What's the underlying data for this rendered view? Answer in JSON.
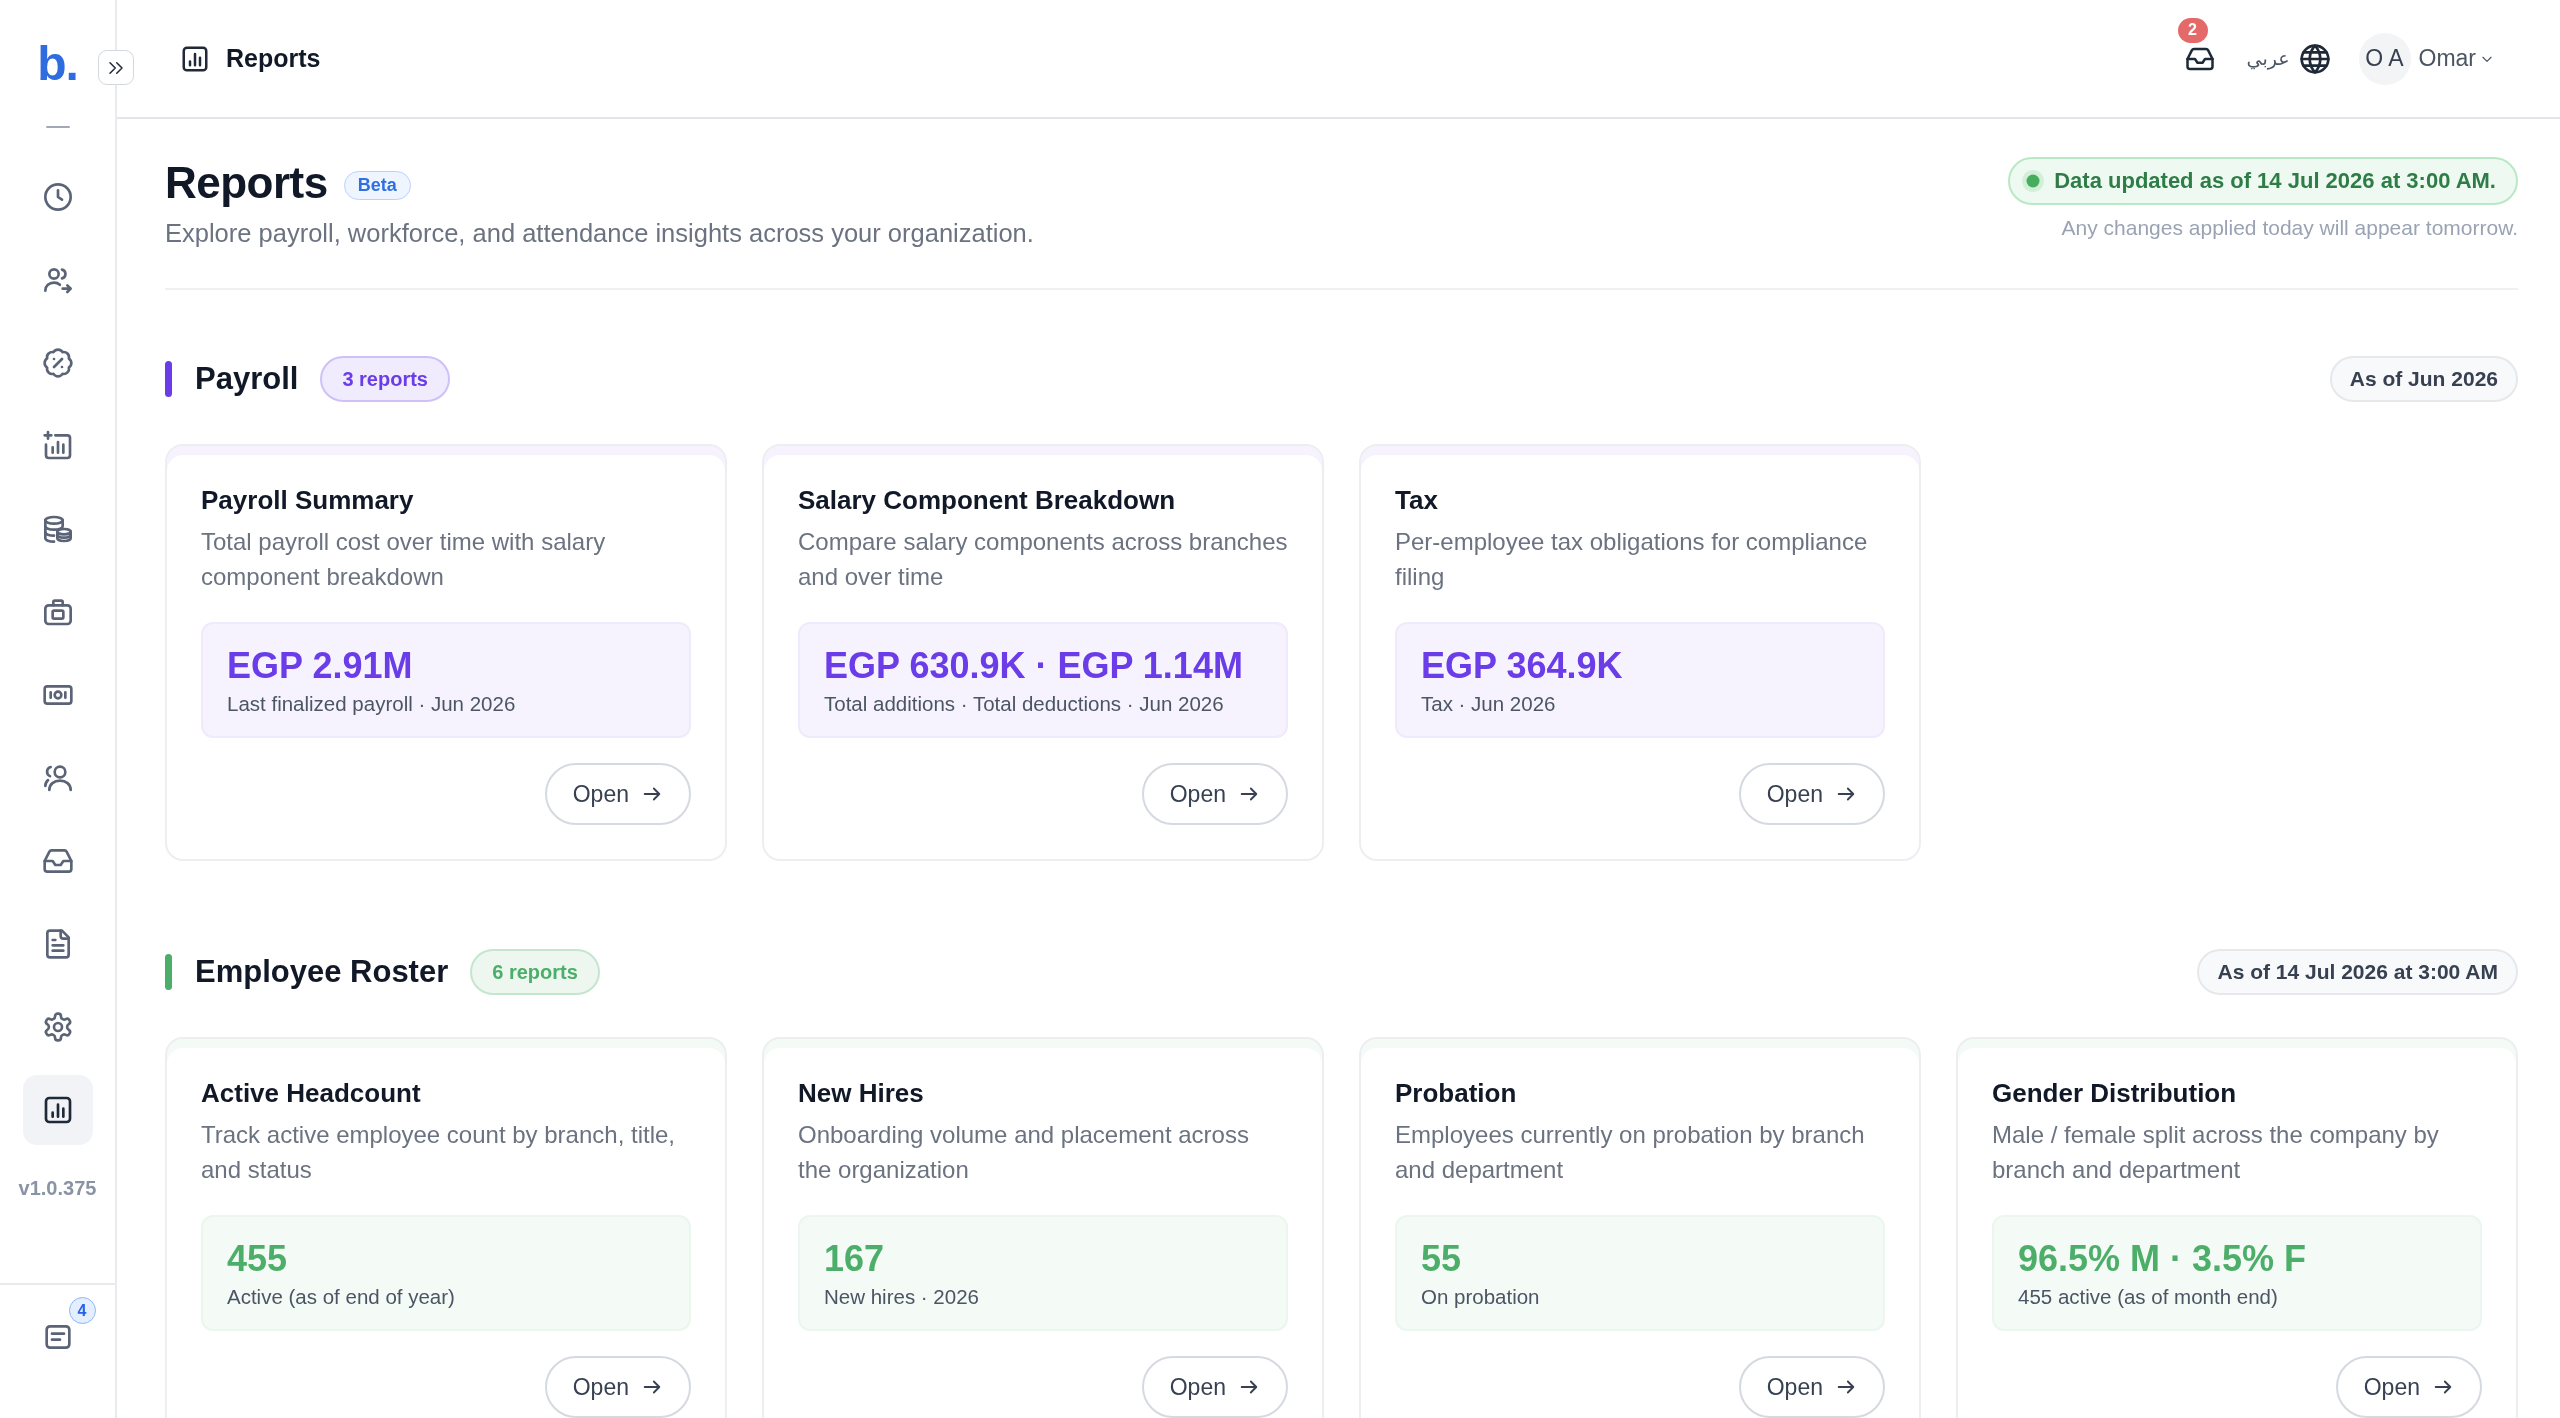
{
  "sidebar": {
    "logo": "b.",
    "items": [
      {
        "selected": false
      },
      {
        "selected": false
      },
      {
        "selected": false
      },
      {
        "selected": false
      },
      {
        "selected": false
      },
      {
        "selected": false
      },
      {
        "selected": false
      },
      {
        "selected": false
      },
      {
        "selected": false
      },
      {
        "selected": false
      },
      {
        "selected": false
      },
      {
        "selected": true
      }
    ],
    "version": "v1.0.375",
    "footer_badge": "4"
  },
  "topbar": {
    "title": "Reports",
    "notification_count": "2",
    "language": "عربي",
    "user": {
      "initials": "O A",
      "name": "Omar"
    }
  },
  "header": {
    "title": "Reports",
    "badge": "Beta",
    "subtitle": "Explore payroll, workforce, and attendance insights across your organization.",
    "status": "Data updated as of 14 Jul 2026 at 3:00 AM.",
    "status_note": "Any changes applied today will appear tomorrow."
  },
  "sections": [
    {
      "title": "Payroll",
      "count": "3 reports",
      "as_of": "As of Jun 2026",
      "color": "#6a3de8",
      "reports": [
        {
          "title": "Payroll Summary",
          "description": "Total payroll cost over time with salary component breakdown",
          "value": "EGP 2.91M",
          "caption": "Last finalized payroll · Jun 2026",
          "action": "Open"
        },
        {
          "title": "Salary Component Breakdown",
          "description": "Compare salary components across branches and over time",
          "value": "EGP 630.9K · EGP 1.14M",
          "caption": "Total additions · Total deductions · Jun 2026",
          "action": "Open"
        },
        {
          "title": "Tax",
          "description": "Per-employee tax obligations for compliance filing",
          "value": "EGP 364.9K",
          "caption": "Tax · Jun 2026",
          "action": "Open"
        }
      ]
    },
    {
      "title": "Employee Roster",
      "count": "6 reports",
      "as_of": "As of 14 Jul 2026 at 3:00 AM",
      "color": "#4cae68",
      "reports": [
        {
          "title": "Active Headcount",
          "description": "Track active employee count by branch, title, and status",
          "value": "455",
          "caption": "Active (as of end of year)",
          "action": "Open"
        },
        {
          "title": "New Hires",
          "description": "Onboarding volume and placement across the organization",
          "value": "167",
          "caption": "New hires · 2026",
          "action": "Open"
        },
        {
          "title": "Probation",
          "description": "Employees currently on probation by branch and department",
          "value": "55",
          "caption": "On probation",
          "action": "Open"
        },
        {
          "title": "Gender Distribution",
          "description": "Male / female split across the company by branch and department",
          "value": "96.5% M · 3.5% F",
          "caption": "455 active (as of month end)",
          "action": "Open"
        }
      ]
    }
  ]
}
